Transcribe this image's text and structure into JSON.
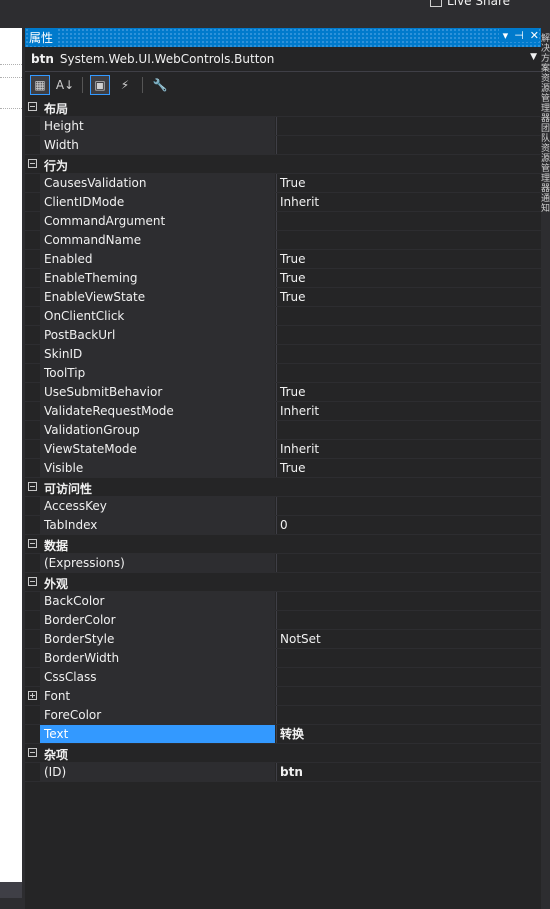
{
  "topbar": {
    "live_share": "Live Share",
    "more": "⌃"
  },
  "panel": {
    "title": "属性",
    "buttons": {
      "dropdown": "▾",
      "pin": "⊣",
      "close": "✕"
    },
    "object": {
      "name": "btn",
      "type": "System.Web.UI.WebControls.Button",
      "drop": "▼"
    },
    "toolbar": {
      "categorized": "▦",
      "alphabetical": "A↓",
      "properties": "▣",
      "events": "⚡",
      "pages": "🔧"
    },
    "grid": {
      "layout": {
        "label": "布局",
        "rows": [
          {
            "name": "Height",
            "value": ""
          },
          {
            "name": "Width",
            "value": ""
          }
        ]
      },
      "behavior": {
        "label": "行为",
        "rows": [
          {
            "name": "CausesValidation",
            "value": "True"
          },
          {
            "name": "ClientIDMode",
            "value": "Inherit"
          },
          {
            "name": "CommandArgument",
            "value": ""
          },
          {
            "name": "CommandName",
            "value": ""
          },
          {
            "name": "Enabled",
            "value": "True"
          },
          {
            "name": "EnableTheming",
            "value": "True"
          },
          {
            "name": "EnableViewState",
            "value": "True"
          },
          {
            "name": "OnClientClick",
            "value": ""
          },
          {
            "name": "PostBackUrl",
            "value": ""
          },
          {
            "name": "SkinID",
            "value": ""
          },
          {
            "name": "ToolTip",
            "value": ""
          },
          {
            "name": "UseSubmitBehavior",
            "value": "True"
          },
          {
            "name": "ValidateRequestMode",
            "value": "Inherit"
          },
          {
            "name": "ValidationGroup",
            "value": ""
          },
          {
            "name": "ViewStateMode",
            "value": "Inherit"
          },
          {
            "name": "Visible",
            "value": "True"
          }
        ]
      },
      "accessibility": {
        "label": "可访问性",
        "rows": [
          {
            "name": "AccessKey",
            "value": ""
          },
          {
            "name": "TabIndex",
            "value": "0"
          }
        ]
      },
      "data": {
        "label": "数据",
        "rows": [
          {
            "name": "(Expressions)",
            "value": ""
          }
        ]
      },
      "appearance": {
        "label": "外观",
        "rows": [
          {
            "name": "BackColor",
            "value": ""
          },
          {
            "name": "BorderColor",
            "value": ""
          },
          {
            "name": "BorderStyle",
            "value": "NotSet"
          },
          {
            "name": "BorderWidth",
            "value": ""
          },
          {
            "name": "CssClass",
            "value": ""
          },
          {
            "name": "Font",
            "value": ""
          },
          {
            "name": "ForeColor",
            "value": ""
          },
          {
            "name": "Text",
            "value": "转换"
          }
        ]
      },
      "misc": {
        "label": "杂项",
        "rows": [
          {
            "name": "(ID)",
            "value": "btn"
          }
        ]
      }
    }
  },
  "right_strip": {
    "chars": [
      "解",
      "决",
      "方",
      "案",
      "资",
      "源",
      "管",
      "理",
      "器",
      "团",
      "队",
      "资",
      "源",
      "管",
      "理",
      "器",
      "通",
      "知"
    ]
  },
  "colors": {
    "accent": "#007acc",
    "selection": "#3399ff",
    "background": "#252526"
  }
}
